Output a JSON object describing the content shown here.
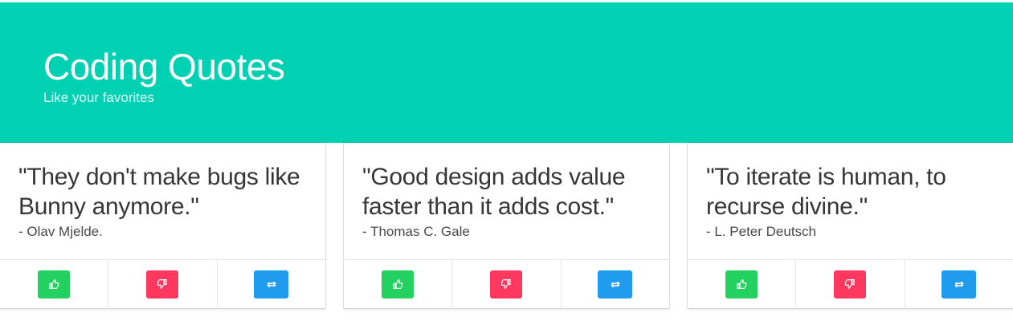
{
  "hero": {
    "title": "Coding Quotes",
    "subtitle": "Like your favorites",
    "background_color": "#00d1b2"
  },
  "quotes": [
    {
      "text": "\"They don't make bugs like Bunny anymore.\"",
      "author": "- Olav Mjelde."
    },
    {
      "text": "\"Good design adds value faster than it adds cost.\"",
      "author": "- Thomas C. Gale"
    },
    {
      "text": "\"To iterate is human, to recurse divine.\"",
      "author": "- L. Peter Deutsch"
    }
  ],
  "actions": {
    "like": {
      "icon": "thumbs-up-icon",
      "color": "#23d160"
    },
    "dislike": {
      "icon": "thumbs-down-icon",
      "color": "#ff3860"
    },
    "retweet": {
      "icon": "retweet-icon",
      "color": "#209cee"
    }
  }
}
